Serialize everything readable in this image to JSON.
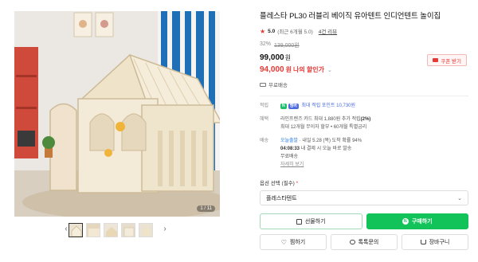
{
  "product": {
    "title": "플레스타 PL30 러블리 베이직 유아텐트 인디언텐트 놀이집",
    "rating": "5.0",
    "rating_detail": "(최근 6개월 5.0)",
    "review_link": "4건 리뷰",
    "discount_rate": "32%",
    "original_price": "139,000원",
    "price": "99,000",
    "price_unit": "원",
    "my_price": "94,000",
    "my_price_unit": "원",
    "my_price_label": "나의 할인가",
    "coupon_button": "쿠폰 받기",
    "shipping": "무료배송"
  },
  "details": {
    "points_label": "적립",
    "points_badges": [
      "N",
      "멤버"
    ],
    "points_text": "최대 적립 포인트 10,730원",
    "benefit_label": "혜택",
    "benefit_line1_pre": "라인프렌즈 카드 최대 1,880원 추가 적립",
    "benefit_line1_rate": "(2%)",
    "benefit_line1_post": "",
    "benefit_line2": "최대 12개월 무이자 할부 • 60개월 특별금리",
    "delivery_label": "배송",
    "delivery_badge": "오늘출발",
    "delivery_line1": "· 내일 5.28 (목) 도착 확률 94%",
    "delivery_line2_time": "04:08:33",
    "delivery_line2": "내 결제 시 오늘 바로 발송",
    "delivery_line3": "무료배송",
    "more_link": "자세히 보기"
  },
  "option": {
    "label": "옵션 선택",
    "required_text": "(필수)",
    "required_mark": "*",
    "selected": "플레스타텐트"
  },
  "buttons": {
    "gift": "선물하기",
    "buy": "구매하기",
    "wish": "찜하기",
    "inquiry": "톡톡문의",
    "cart": "장바구니"
  },
  "gallery": {
    "counter": "1 / 11",
    "thumb_count": 5,
    "colors": {
      "wall": "#e9e6e1",
      "curtain_blue": "#1e6fb5",
      "floor": "#d9cfbe",
      "tent": "#f3ead8",
      "tent_edge": "#d9c8a8",
      "rug": "#c9b69a"
    }
  },
  "colors": {
    "accent_red": "#e53935",
    "buy_green": "#12c35a",
    "points_blue": "#4b6cdf"
  }
}
